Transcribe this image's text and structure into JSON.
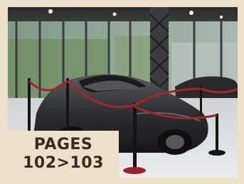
{
  "badge": {
    "line1": "PAGES",
    "line2": "102>103"
  },
  "colors": {
    "background": "#ede0ca",
    "badge_text": "#3a2a22",
    "car": "#2e2e30",
    "rope": "#a3262a"
  }
}
